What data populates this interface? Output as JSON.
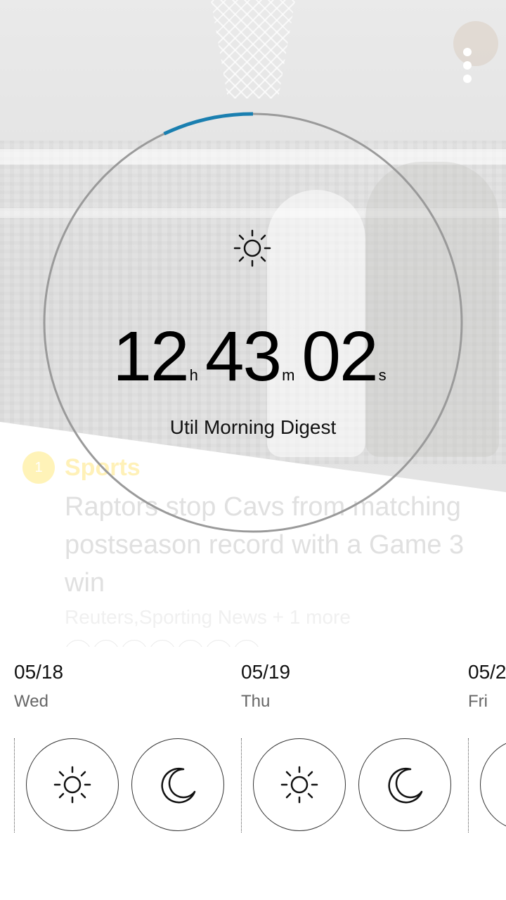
{
  "timer": {
    "hours": "12",
    "hours_unit": "h",
    "minutes": "43",
    "minutes_unit": "m",
    "seconds": "02",
    "seconds_unit": "s",
    "caption": "Util Morning Digest",
    "icon": "sun-icon",
    "progress_fraction": 0.07,
    "accent_color": "#1a7fb0"
  },
  "news": {
    "index": "1",
    "category": "Sports",
    "headline": "Raptors stop Cavs from matching postseason record with a Game 3 win",
    "source": "Reuters,Sporting News + 1 more"
  },
  "forecast": {
    "days": [
      {
        "date": "05/18",
        "weekday": "Wed",
        "slots": [
          "sun-icon",
          "moon-icon"
        ]
      },
      {
        "date": "05/19",
        "weekday": "Thu",
        "slots": [
          "sun-icon",
          "moon-icon"
        ]
      },
      {
        "date": "05/2",
        "weekday": "Fri",
        "slots": [
          "sun-icon"
        ]
      }
    ]
  },
  "menu": {
    "icon": "more-vertical-icon"
  }
}
